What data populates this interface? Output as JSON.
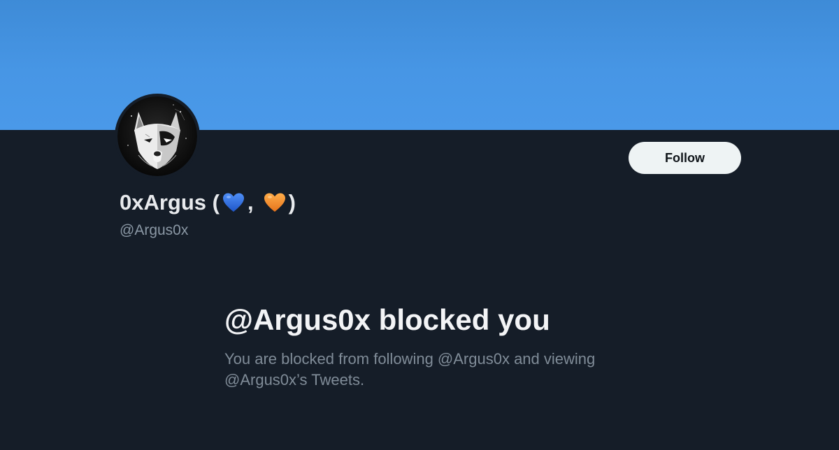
{
  "profile": {
    "name_prefix": "0xArgus (",
    "name_separator": ",",
    "name_suffix": ")",
    "heart_1_icon": "blue-heart-icon",
    "heart_2_icon": "orange-heart-icon",
    "handle": "@Argus0x",
    "avatar_icon": "wolf-avatar-icon"
  },
  "actions": {
    "follow_label": "Follow"
  },
  "blocked": {
    "title": "@Argus0x blocked you",
    "message": "You are blocked from following @Argus0x and viewing @Argus0x’s Tweets."
  },
  "colors": {
    "banner": "#4796e5",
    "background": "#151d28",
    "follow_button_bg": "#eef3f4",
    "blue_heart": "#2b6fe3",
    "orange_heart": "#f08a24"
  }
}
